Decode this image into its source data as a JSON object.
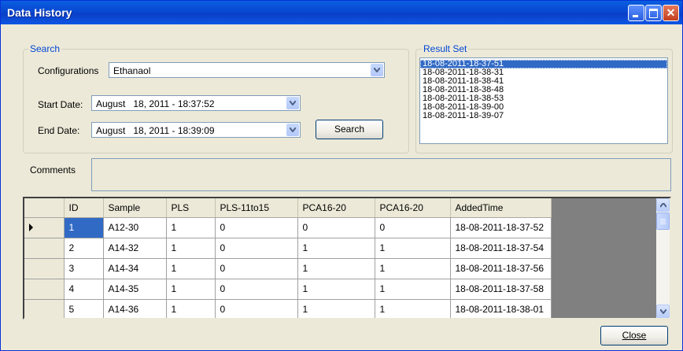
{
  "window": {
    "title": "Data History"
  },
  "search": {
    "legend": "Search",
    "configurations_label": "Configurations",
    "configurations_value": "Ethanaol",
    "start_date_label": "Start Date:",
    "start_date_value": "August   18, 2011 - 18:37:52",
    "end_date_label": "End Date:",
    "end_date_value": "August   18, 2011 - 18:39:09",
    "search_button": "Search"
  },
  "result_set": {
    "legend": "Result Set",
    "items": [
      "18-08-2011-18-37-51",
      "18-08-2011-18-38-31",
      "18-08-2011-18-38-41",
      "18-08-2011-18-38-48",
      "18-08-2011-18-38-53",
      "18-08-2011-18-39-00",
      "18-08-2011-18-39-07"
    ],
    "selected_index": 0
  },
  "comments": {
    "label": "Comments",
    "value": ""
  },
  "grid": {
    "columns": [
      "ID",
      "Sample",
      "PLS",
      "PLS-11to15",
      "PCA16-20",
      "PCA16-20",
      "AddedTime"
    ],
    "rows": [
      [
        "1",
        "A12-30",
        "1",
        "0",
        "0",
        "0",
        "18-08-2011-18-37-52"
      ],
      [
        "2",
        "A14-32",
        "1",
        "0",
        "1",
        "1",
        "18-08-2011-18-37-54"
      ],
      [
        "3",
        "A14-34",
        "1",
        "0",
        "1",
        "1",
        "18-08-2011-18-37-56"
      ],
      [
        "4",
        "A14-35",
        "1",
        "0",
        "1",
        "1",
        "18-08-2011-18-37-58"
      ],
      [
        "5",
        "A14-36",
        "1",
        "0",
        "1",
        "1",
        "18-08-2011-18-38-01"
      ]
    ],
    "current_row": 0
  },
  "buttons": {
    "close": "Close"
  }
}
